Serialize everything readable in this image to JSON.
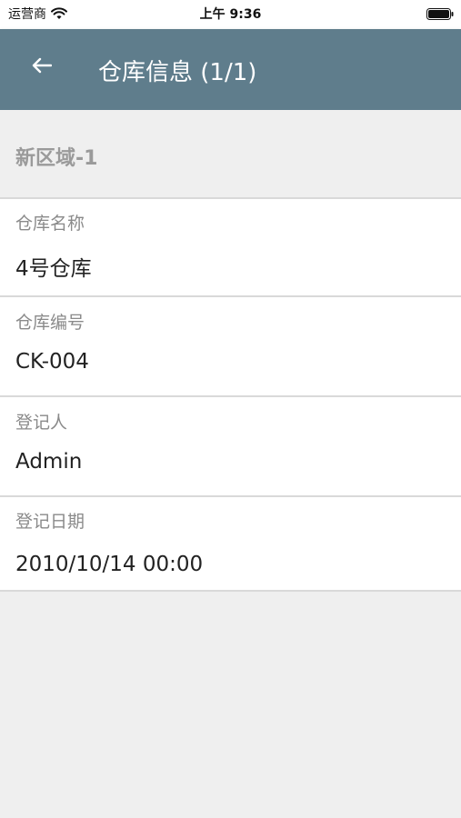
{
  "status_bar": {
    "carrier": "运营商",
    "time": "上午 9:36"
  },
  "header": {
    "title": "仓库信息 (1/1)",
    "back_icon": "arrow-left-icon"
  },
  "section": {
    "title": "新区域-1"
  },
  "fields": [
    {
      "label": "仓库名称",
      "value": "4号仓库"
    },
    {
      "label": "仓库编号",
      "value": "CK-004"
    },
    {
      "label": "登记人",
      "value": "Admin"
    },
    {
      "label": "登记日期",
      "value": "2010/10/14 00:00"
    }
  ],
  "colors": {
    "app_bar": "#5f7d8c",
    "background": "#efefef",
    "card": "#ffffff"
  }
}
